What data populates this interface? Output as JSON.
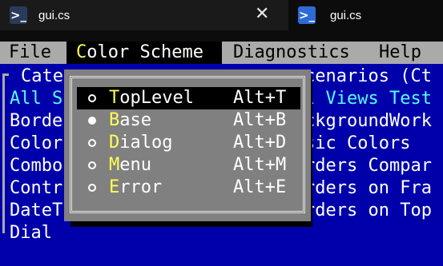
{
  "tabs": [
    {
      "title": "gui.cs",
      "icon": "powershell-icon",
      "close": "✕"
    },
    {
      "title": "gui.cs",
      "icon": "powershell-icon"
    }
  ],
  "menubar": {
    "items": [
      {
        "hotkey": "F",
        "rest": "ile"
      },
      {
        "hotkey": "C",
        "rest": "olor Scheme"
      },
      {
        "hotkey": "D",
        "rest": "iagnostics"
      },
      {
        "hotkey": "H",
        "rest": "elp"
      }
    ]
  },
  "left_list": {
    "header": "Cate",
    "rows": [
      "All S",
      "Borde",
      "Color",
      "Combo",
      "Contr",
      "DateT",
      "Dial"
    ]
  },
  "right_list": {
    "rows": [
      "cenarios (Ct",
      "l Views Test",
      "ckgroundWork",
      "sic Colors",
      "rders Compar",
      "rders on Fra",
      "rders on Top",
      ""
    ]
  },
  "color_menu": {
    "items": [
      {
        "hotkey": "T",
        "rest": "opLevel",
        "shortcut": "Alt+T",
        "selected": true,
        "checked": false
      },
      {
        "hotkey": "B",
        "rest": "ase",
        "shortcut": "Alt+B",
        "selected": false,
        "checked": true
      },
      {
        "hotkey": "D",
        "rest": "ialog",
        "shortcut": "Alt+D",
        "selected": false,
        "checked": false
      },
      {
        "hotkey": "M",
        "rest": "enu",
        "shortcut": "Alt+M",
        "selected": false,
        "checked": false
      },
      {
        "hotkey": "E",
        "rest": "rror",
        "shortcut": "Alt+E",
        "selected": false,
        "checked": false
      }
    ]
  },
  "colors": {
    "console_bg": "#0000aa",
    "menubar_bg": "#aaaaaa",
    "menu_bg": "#808080",
    "hotkey": "#ffff55",
    "list_text": "#55ffff"
  }
}
